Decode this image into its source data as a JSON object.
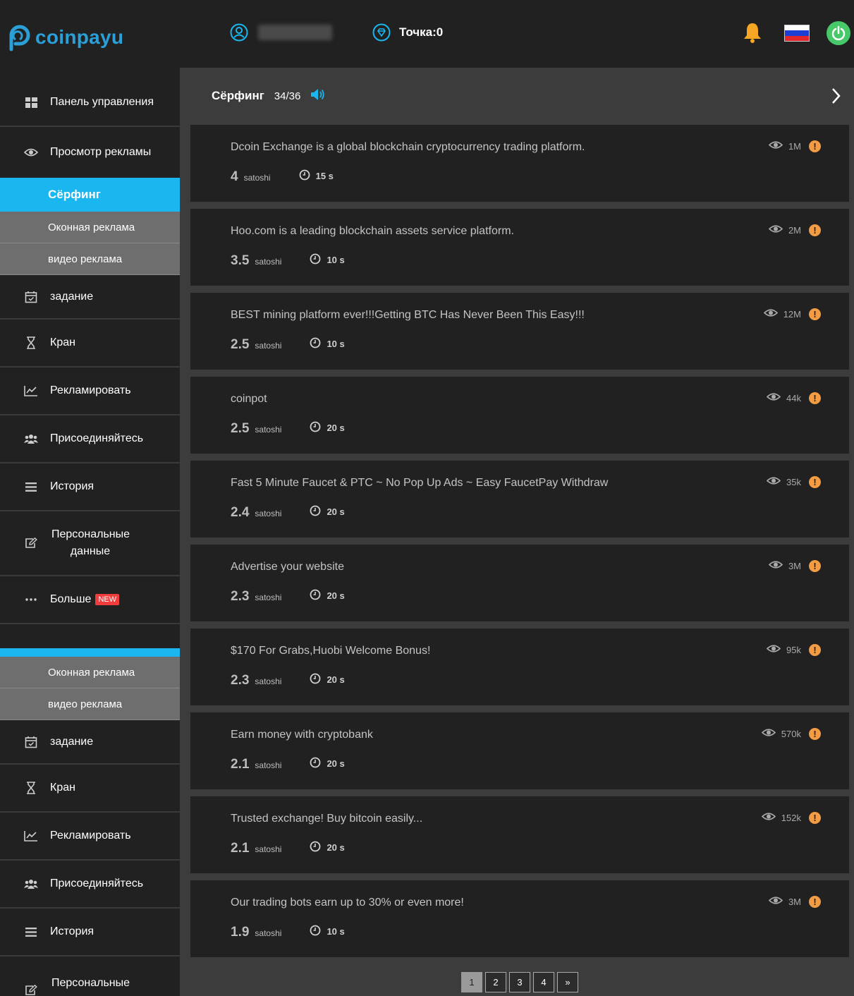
{
  "app": {
    "logo_text": "coinpayu",
    "accent": "#1ab6f0"
  },
  "topbar": {
    "points_label": "Точка:0",
    "icons": [
      "user-icon",
      "diamond-icon",
      "bell-icon",
      "flag-ru-icon",
      "power-icon"
    ]
  },
  "sidebar": {
    "dashboard": "Панель управления",
    "view_ads": "Просмотр рекламы",
    "surfing": "Сёрфинг",
    "window_ads": "Оконная реклама",
    "video_ads": "видео реклама",
    "task": "задание",
    "faucet": "Кран",
    "advertise": "Рекламировать",
    "join": "Присоединяйтесь",
    "history": "История",
    "personal": "Персональные данные",
    "personal_top": "Персональные",
    "more": "Больше",
    "new_badge": "NEW"
  },
  "main": {
    "title": "Сёрфинг",
    "count": "34/36",
    "ads": [
      {
        "title": "Dcoin Exchange is a global blockchain cryptocurrency trading platform.",
        "amount": "4",
        "unit": "satoshi",
        "time": "15 s",
        "views": "1M"
      },
      {
        "title": "Hoo.com is a leading blockchain assets service platform.",
        "amount": "3.5",
        "unit": "satoshi",
        "time": "10 s",
        "views": "2M"
      },
      {
        "title": "BEST mining platform ever!!!Getting BTC Has Never Been This Easy!!!",
        "amount": "2.5",
        "unit": "satoshi",
        "time": "10 s",
        "views": "12M"
      },
      {
        "title": "coinpot",
        "amount": "2.5",
        "unit": "satoshi",
        "time": "20 s",
        "views": "44k"
      },
      {
        "title": "Fast 5 Minute Faucet & PTC ~ No Pop Up Ads ~ Easy FaucetPay Withdraw",
        "amount": "2.4",
        "unit": "satoshi",
        "time": "20 s",
        "views": "35k"
      },
      {
        "title": "Advertise your website",
        "amount": "2.3",
        "unit": "satoshi",
        "time": "20 s",
        "views": "3M"
      },
      {
        "title": "$170 For Grabs,Huobi Welcome Bonus!",
        "amount": "2.3",
        "unit": "satoshi",
        "time": "20 s",
        "views": "95k"
      },
      {
        "title": "Earn money with cryptobank",
        "amount": "2.1",
        "unit": "satoshi",
        "time": "20 s",
        "views": "570k"
      },
      {
        "title": "Trusted exchange! Buy bitcoin easily...",
        "amount": "2.1",
        "unit": "satoshi",
        "time": "20 s",
        "views": "152k"
      },
      {
        "title": "Our trading bots earn up to 30% or even more!",
        "amount": "1.9",
        "unit": "satoshi",
        "time": "10 s",
        "views": "3M"
      }
    ]
  },
  "pagination": {
    "pages": [
      "1",
      "2",
      "3",
      "4"
    ],
    "next": "»",
    "current": "1"
  }
}
